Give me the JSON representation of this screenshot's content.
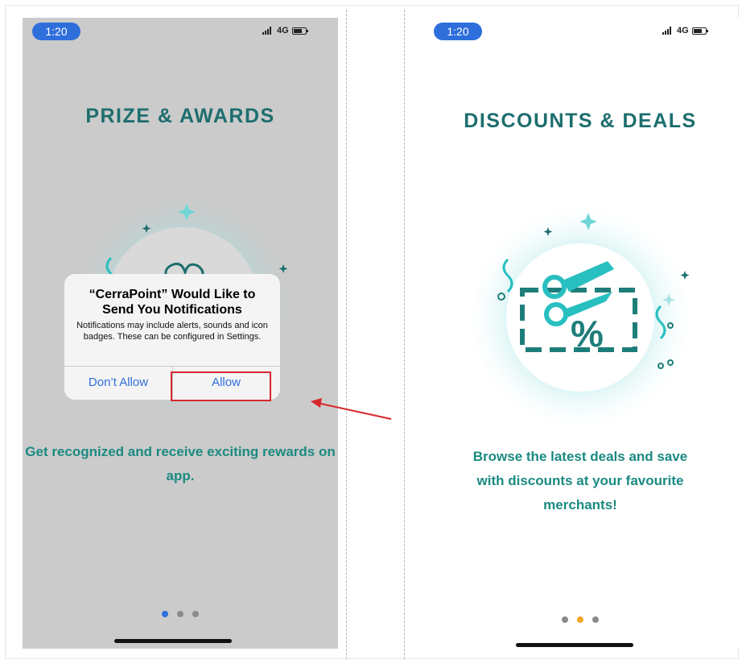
{
  "left_screen": {
    "status_time": "1:20",
    "status_network": "4G",
    "title": "PRIZE & AWARDS",
    "description": "Get recognized and receive exciting rewards on app.",
    "dialog": {
      "title": "“CerraPoint” Would Like to Send You Notifications",
      "message": "Notifications may include alerts, sounds and icon badges. These can be configured in Settings.",
      "dont_allow_label": "Don’t Allow",
      "allow_label": "Allow"
    },
    "page_dots": {
      "count": 3,
      "active": 0
    }
  },
  "right_screen": {
    "status_time": "1:20",
    "status_network": "4G",
    "title": "DISCOUNTS & DEALS",
    "description": "Browse the latest deals and save with discounts at your favourite merchants!",
    "page_dots": {
      "count": 3,
      "active": 1
    }
  },
  "colors": {
    "teal_title": "#1e6e6e",
    "teal_text": "#1b8a82",
    "accent_blue": "#2f6fdc",
    "dot_orange": "#f5a623",
    "highlight_red": "#d9262e",
    "overlay_grey": "#cbcbcb"
  },
  "icons": {
    "left_illustration": "flower-award-icon",
    "right_illustration": "scissors-coupon-percent-icon"
  }
}
